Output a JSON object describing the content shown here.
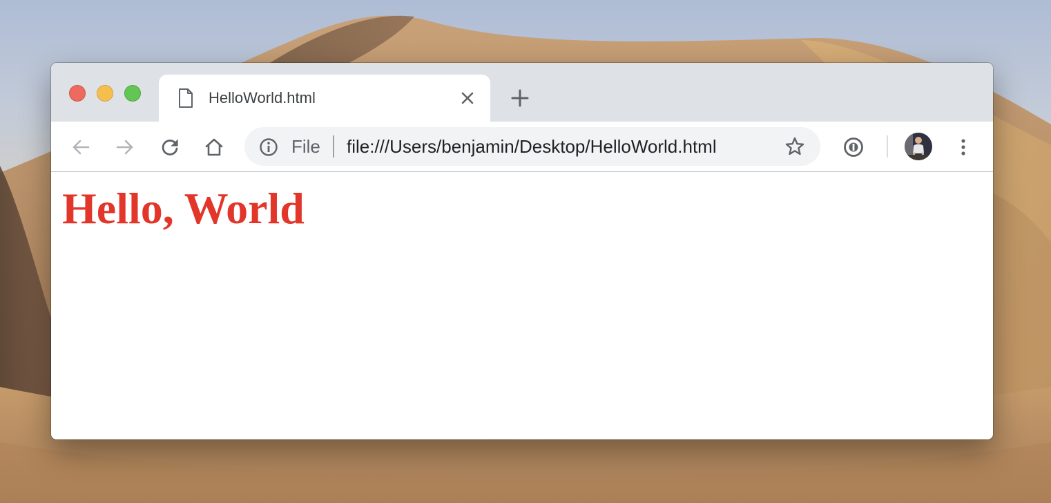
{
  "desktop": {
    "wallpaper": "desert-dunes"
  },
  "window": {
    "traffic_lights": {
      "close_color": "#ed6a5e",
      "minimize_color": "#f5bf4f",
      "zoom_color": "#62c554"
    }
  },
  "tab": {
    "icon": "document-icon",
    "title": "HelloWorld.html",
    "close_icon": "close-icon"
  },
  "new_tab": {
    "icon": "plus-icon"
  },
  "toolbar": {
    "back_icon": "arrow-left-icon",
    "back_enabled": false,
    "forward_icon": "arrow-right-icon",
    "forward_enabled": false,
    "reload_icon": "reload-icon",
    "home_icon": "home-icon",
    "extension_icon": "password-manager-icon",
    "menu_icon": "kebab-menu-icon"
  },
  "omnibox": {
    "info_icon": "info-icon",
    "scheme_label": "File",
    "url": "file:///Users/benjamin/Desktop/HelloWorld.html",
    "bookmark_icon": "star-icon"
  },
  "profile": {
    "avatar": "profile-photo"
  },
  "page": {
    "heading": "Hello, World",
    "heading_color": "#e2362a"
  }
}
